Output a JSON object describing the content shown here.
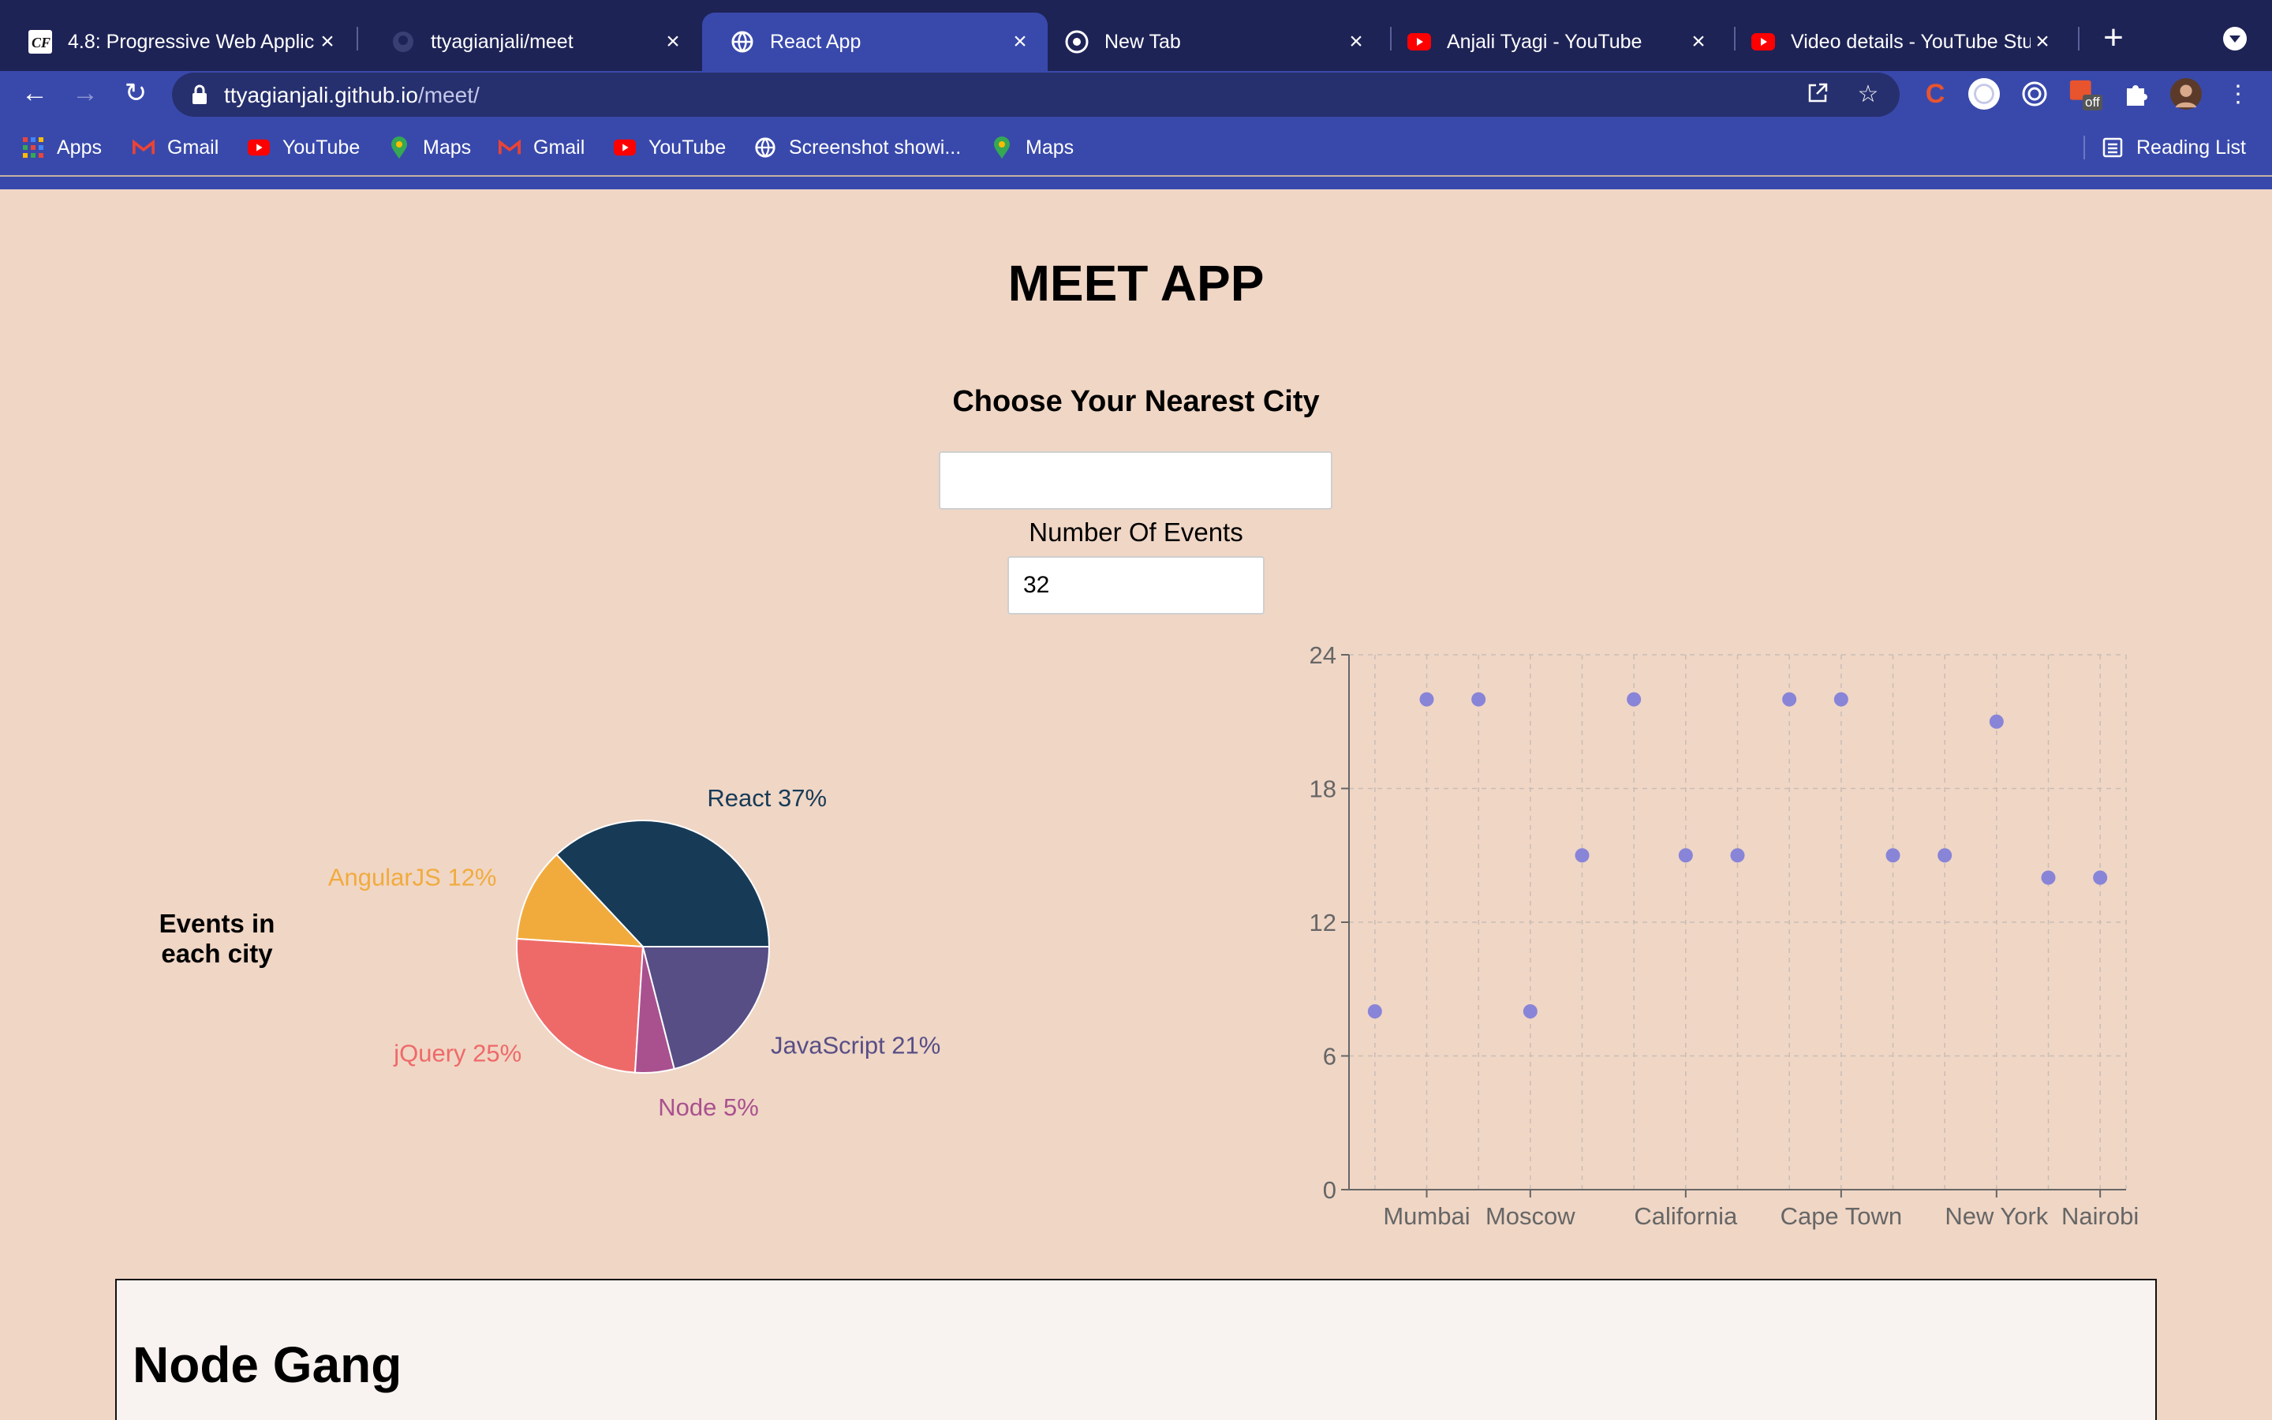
{
  "browser": {
    "tabs": [
      {
        "title": "4.8: Progressive Web Applic",
        "icon": "cf-icon",
        "active": false
      },
      {
        "title": "ttyagianjali/meet",
        "icon": "github-icon",
        "active": false
      },
      {
        "title": "React App",
        "icon": "globe-icon",
        "active": true
      },
      {
        "title": "New Tab",
        "icon": "chrome-icon",
        "active": false
      },
      {
        "title": "Anjali Tyagi - YouTube",
        "icon": "youtube-icon",
        "active": false
      },
      {
        "title": "Video details - YouTube Stu",
        "icon": "youtube-icon",
        "active": false
      }
    ],
    "url_host": "ttyagianjali.github.io",
    "url_path": "/meet/",
    "bookmarks": [
      {
        "label": "Apps",
        "icon": "apps-grid-icon"
      },
      {
        "label": "Gmail",
        "icon": "gmail-icon"
      },
      {
        "label": "YouTube",
        "icon": "youtube-icon"
      },
      {
        "label": "Maps",
        "icon": "maps-icon"
      },
      {
        "label": "Gmail",
        "icon": "gmail-icon"
      },
      {
        "label": "YouTube",
        "icon": "youtube-icon"
      },
      {
        "label": "Screenshot showi...",
        "icon": "globe-icon"
      },
      {
        "label": "Maps",
        "icon": "maps-icon"
      }
    ],
    "reading_list": "Reading List",
    "extension_badge": "off"
  },
  "app": {
    "title": "MEET APP",
    "city_label": "Choose Your Nearest City",
    "city_value": "",
    "events_label": "Number Of Events",
    "events_value": "32",
    "pie_caption": "Events in each city",
    "event_title": "Node Gang"
  },
  "colors": {
    "page_bg": "#f0d6c5",
    "scatter_point": "#8884d8",
    "react": "#173b57",
    "javascript": "#574e86",
    "node": "#a9518f",
    "jquery": "#ee6a69",
    "angularjs": "#f1ab3d"
  },
  "chart_data": [
    {
      "type": "pie",
      "title": "Events in each city",
      "slices": [
        {
          "label": "React",
          "percent": 37,
          "color": "#173b57"
        },
        {
          "label": "AngularJS",
          "percent": 12,
          "color": "#f1ab3d"
        },
        {
          "label": "jQuery",
          "percent": 25,
          "color": "#ee6a69"
        },
        {
          "label": "Node",
          "percent": 5,
          "color": "#a9518f"
        },
        {
          "label": "JavaScript",
          "percent": 21,
          "color": "#574e86"
        }
      ]
    },
    {
      "type": "scatter",
      "xlabel": "",
      "ylabel": "",
      "ylim": [
        0,
        24
      ],
      "yticks": [
        0,
        6,
        12,
        18,
        24
      ],
      "x_tick_labels": [
        "Mumbai",
        "Moscow",
        "California",
        "Cape Town",
        "New York",
        "Nairobi"
      ],
      "grid": true,
      "points": [
        {
          "x": "",
          "y": 8
        },
        {
          "x": "Mumbai",
          "y": 22
        },
        {
          "x": "",
          "y": 22
        },
        {
          "x": "Moscow",
          "y": 8
        },
        {
          "x": "",
          "y": 15
        },
        {
          "x": "",
          "y": 22
        },
        {
          "x": "California",
          "y": 15
        },
        {
          "x": "",
          "y": 15
        },
        {
          "x": "",
          "y": 22
        },
        {
          "x": "Cape Town",
          "y": 22
        },
        {
          "x": "",
          "y": 15
        },
        {
          "x": "",
          "y": 15
        },
        {
          "x": "New York",
          "y": 21
        },
        {
          "x": "",
          "y": 14
        },
        {
          "x": "Nairobi",
          "y": 14
        }
      ]
    }
  ]
}
